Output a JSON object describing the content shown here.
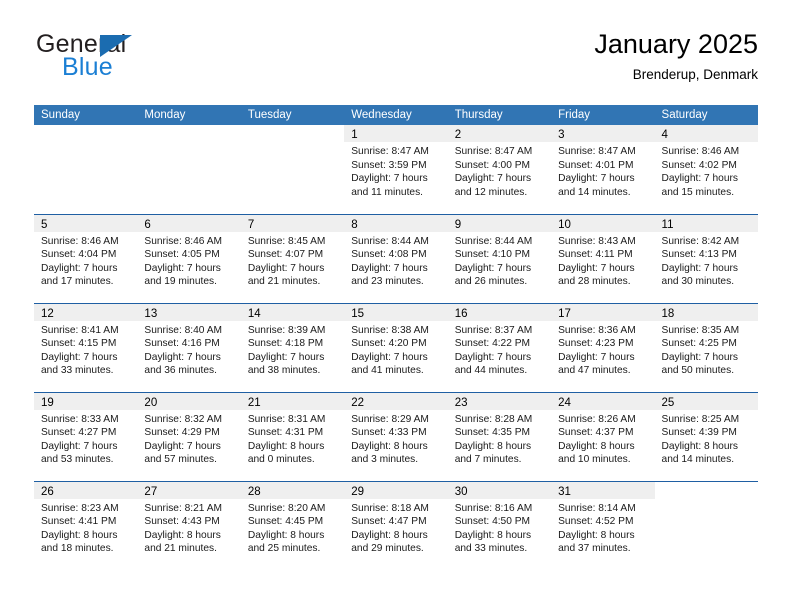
{
  "brand": {
    "line1": "General",
    "line2": "Blue",
    "triangle_color": "#1b6cb0",
    "line1_color": "#231f20",
    "line2_color": "#1b7fd4"
  },
  "header": {
    "title": "January 2025",
    "subtitle": "Brenderup, Denmark"
  },
  "colors": {
    "header_blue": "#3175b4",
    "row_divider_blue": "#1f5fa3",
    "daynum_band": "#efefef",
    "text": "#000000"
  },
  "weekday_headers": [
    "Sunday",
    "Monday",
    "Tuesday",
    "Wednesday",
    "Thursday",
    "Friday",
    "Saturday"
  ],
  "weeks": [
    [
      {
        "day": "",
        "sunrise": "",
        "sunset": "",
        "daylight1": "",
        "daylight2": "",
        "empty": true
      },
      {
        "day": "",
        "sunrise": "",
        "sunset": "",
        "daylight1": "",
        "daylight2": "",
        "empty": true
      },
      {
        "day": "",
        "sunrise": "",
        "sunset": "",
        "daylight1": "",
        "daylight2": "",
        "empty": true
      },
      {
        "day": "1",
        "sunrise": "Sunrise: 8:47 AM",
        "sunset": "Sunset: 3:59 PM",
        "daylight1": "Daylight: 7 hours",
        "daylight2": "and 11 minutes.",
        "empty": false
      },
      {
        "day": "2",
        "sunrise": "Sunrise: 8:47 AM",
        "sunset": "Sunset: 4:00 PM",
        "daylight1": "Daylight: 7 hours",
        "daylight2": "and 12 minutes.",
        "empty": false
      },
      {
        "day": "3",
        "sunrise": "Sunrise: 8:47 AM",
        "sunset": "Sunset: 4:01 PM",
        "daylight1": "Daylight: 7 hours",
        "daylight2": "and 14 minutes.",
        "empty": false
      },
      {
        "day": "4",
        "sunrise": "Sunrise: 8:46 AM",
        "sunset": "Sunset: 4:02 PM",
        "daylight1": "Daylight: 7 hours",
        "daylight2": "and 15 minutes.",
        "empty": false
      }
    ],
    [
      {
        "day": "5",
        "sunrise": "Sunrise: 8:46 AM",
        "sunset": "Sunset: 4:04 PM",
        "daylight1": "Daylight: 7 hours",
        "daylight2": "and 17 minutes.",
        "empty": false
      },
      {
        "day": "6",
        "sunrise": "Sunrise: 8:46 AM",
        "sunset": "Sunset: 4:05 PM",
        "daylight1": "Daylight: 7 hours",
        "daylight2": "and 19 minutes.",
        "empty": false
      },
      {
        "day": "7",
        "sunrise": "Sunrise: 8:45 AM",
        "sunset": "Sunset: 4:07 PM",
        "daylight1": "Daylight: 7 hours",
        "daylight2": "and 21 minutes.",
        "empty": false
      },
      {
        "day": "8",
        "sunrise": "Sunrise: 8:44 AM",
        "sunset": "Sunset: 4:08 PM",
        "daylight1": "Daylight: 7 hours",
        "daylight2": "and 23 minutes.",
        "empty": false
      },
      {
        "day": "9",
        "sunrise": "Sunrise: 8:44 AM",
        "sunset": "Sunset: 4:10 PM",
        "daylight1": "Daylight: 7 hours",
        "daylight2": "and 26 minutes.",
        "empty": false
      },
      {
        "day": "10",
        "sunrise": "Sunrise: 8:43 AM",
        "sunset": "Sunset: 4:11 PM",
        "daylight1": "Daylight: 7 hours",
        "daylight2": "and 28 minutes.",
        "empty": false
      },
      {
        "day": "11",
        "sunrise": "Sunrise: 8:42 AM",
        "sunset": "Sunset: 4:13 PM",
        "daylight1": "Daylight: 7 hours",
        "daylight2": "and 30 minutes.",
        "empty": false
      }
    ],
    [
      {
        "day": "12",
        "sunrise": "Sunrise: 8:41 AM",
        "sunset": "Sunset: 4:15 PM",
        "daylight1": "Daylight: 7 hours",
        "daylight2": "and 33 minutes.",
        "empty": false
      },
      {
        "day": "13",
        "sunrise": "Sunrise: 8:40 AM",
        "sunset": "Sunset: 4:16 PM",
        "daylight1": "Daylight: 7 hours",
        "daylight2": "and 36 minutes.",
        "empty": false
      },
      {
        "day": "14",
        "sunrise": "Sunrise: 8:39 AM",
        "sunset": "Sunset: 4:18 PM",
        "daylight1": "Daylight: 7 hours",
        "daylight2": "and 38 minutes.",
        "empty": false
      },
      {
        "day": "15",
        "sunrise": "Sunrise: 8:38 AM",
        "sunset": "Sunset: 4:20 PM",
        "daylight1": "Daylight: 7 hours",
        "daylight2": "and 41 minutes.",
        "empty": false
      },
      {
        "day": "16",
        "sunrise": "Sunrise: 8:37 AM",
        "sunset": "Sunset: 4:22 PM",
        "daylight1": "Daylight: 7 hours",
        "daylight2": "and 44 minutes.",
        "empty": false
      },
      {
        "day": "17",
        "sunrise": "Sunrise: 8:36 AM",
        "sunset": "Sunset: 4:23 PM",
        "daylight1": "Daylight: 7 hours",
        "daylight2": "and 47 minutes.",
        "empty": false
      },
      {
        "day": "18",
        "sunrise": "Sunrise: 8:35 AM",
        "sunset": "Sunset: 4:25 PM",
        "daylight1": "Daylight: 7 hours",
        "daylight2": "and 50 minutes.",
        "empty": false
      }
    ],
    [
      {
        "day": "19",
        "sunrise": "Sunrise: 8:33 AM",
        "sunset": "Sunset: 4:27 PM",
        "daylight1": "Daylight: 7 hours",
        "daylight2": "and 53 minutes.",
        "empty": false
      },
      {
        "day": "20",
        "sunrise": "Sunrise: 8:32 AM",
        "sunset": "Sunset: 4:29 PM",
        "daylight1": "Daylight: 7 hours",
        "daylight2": "and 57 minutes.",
        "empty": false
      },
      {
        "day": "21",
        "sunrise": "Sunrise: 8:31 AM",
        "sunset": "Sunset: 4:31 PM",
        "daylight1": "Daylight: 8 hours",
        "daylight2": "and 0 minutes.",
        "empty": false
      },
      {
        "day": "22",
        "sunrise": "Sunrise: 8:29 AM",
        "sunset": "Sunset: 4:33 PM",
        "daylight1": "Daylight: 8 hours",
        "daylight2": "and 3 minutes.",
        "empty": false
      },
      {
        "day": "23",
        "sunrise": "Sunrise: 8:28 AM",
        "sunset": "Sunset: 4:35 PM",
        "daylight1": "Daylight: 8 hours",
        "daylight2": "and 7 minutes.",
        "empty": false
      },
      {
        "day": "24",
        "sunrise": "Sunrise: 8:26 AM",
        "sunset": "Sunset: 4:37 PM",
        "daylight1": "Daylight: 8 hours",
        "daylight2": "and 10 minutes.",
        "empty": false
      },
      {
        "day": "25",
        "sunrise": "Sunrise: 8:25 AM",
        "sunset": "Sunset: 4:39 PM",
        "daylight1": "Daylight: 8 hours",
        "daylight2": "and 14 minutes.",
        "empty": false
      }
    ],
    [
      {
        "day": "26",
        "sunrise": "Sunrise: 8:23 AM",
        "sunset": "Sunset: 4:41 PM",
        "daylight1": "Daylight: 8 hours",
        "daylight2": "and 18 minutes.",
        "empty": false
      },
      {
        "day": "27",
        "sunrise": "Sunrise: 8:21 AM",
        "sunset": "Sunset: 4:43 PM",
        "daylight1": "Daylight: 8 hours",
        "daylight2": "and 21 minutes.",
        "empty": false
      },
      {
        "day": "28",
        "sunrise": "Sunrise: 8:20 AM",
        "sunset": "Sunset: 4:45 PM",
        "daylight1": "Daylight: 8 hours",
        "daylight2": "and 25 minutes.",
        "empty": false
      },
      {
        "day": "29",
        "sunrise": "Sunrise: 8:18 AM",
        "sunset": "Sunset: 4:47 PM",
        "daylight1": "Daylight: 8 hours",
        "daylight2": "and 29 minutes.",
        "empty": false
      },
      {
        "day": "30",
        "sunrise": "Sunrise: 8:16 AM",
        "sunset": "Sunset: 4:50 PM",
        "daylight1": "Daylight: 8 hours",
        "daylight2": "and 33 minutes.",
        "empty": false
      },
      {
        "day": "31",
        "sunrise": "Sunrise: 8:14 AM",
        "sunset": "Sunset: 4:52 PM",
        "daylight1": "Daylight: 8 hours",
        "daylight2": "and 37 minutes.",
        "empty": false
      },
      {
        "day": "",
        "sunrise": "",
        "sunset": "",
        "daylight1": "",
        "daylight2": "",
        "empty": true
      }
    ]
  ]
}
